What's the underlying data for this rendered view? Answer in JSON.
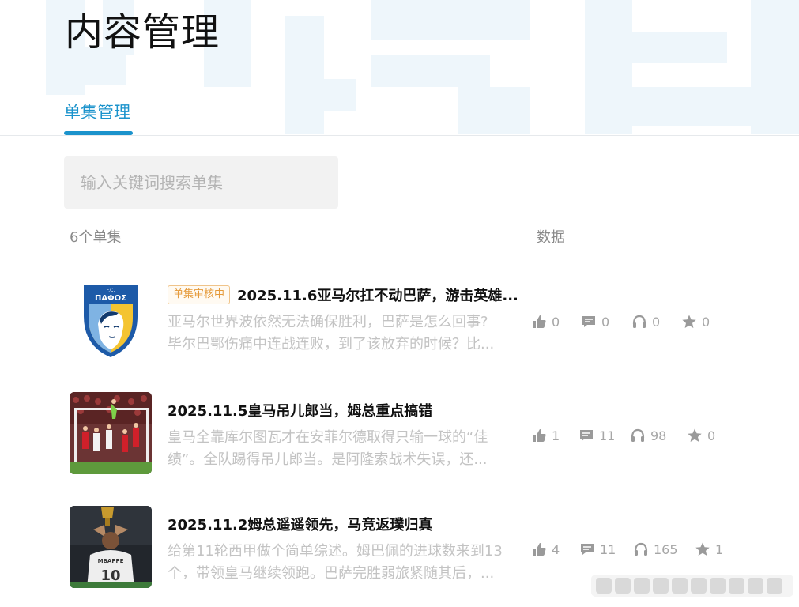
{
  "header": {
    "title": "内容管理"
  },
  "tabs": [
    {
      "label": "单集管理",
      "active": true
    }
  ],
  "search": {
    "placeholder": "输入关键词搜索单集",
    "value": ""
  },
  "list": {
    "count_label": "6个单集",
    "data_label": "数据",
    "episodes": [
      {
        "badge": "单集审核中",
        "title": "2025.11.6亚马尔扛不动巴萨，游击英雄...",
        "desc_line1": "亚马尔世界波依然无法确保胜利，巴萨是怎么回事?",
        "desc_line2": "毕尔巴鄂伤痛中连战连败，到了该放弃的时候？比...",
        "thumb_icon": "pafos-club-crest",
        "stats": {
          "likes": "0",
          "comments": "0",
          "listens": "0",
          "stars": "0"
        }
      },
      {
        "badge": "",
        "title": "2025.11.5皇马吊儿郎当，姆总重点搞错",
        "desc_line1": "皇马全靠库尔图瓦才在安菲尔德取得只输一球的“佳",
        "desc_line2": "绩”。全队踢得吊儿郎当。是阿隆索战术失误，还...",
        "thumb_icon": "football-match-photo",
        "stats": {
          "likes": "1",
          "comments": "11",
          "listens": "98",
          "stars": "0"
        }
      },
      {
        "badge": "",
        "title": "2025.11.2姆总遥遥领先，马竞返璞归真",
        "desc_line1": "给第11轮西甲做个简单综述。姆巴佩的进球数来到13",
        "desc_line2": "个，带领皇马继续领跑。巴萨完胜弱旅紧随其后，...",
        "thumb_icon": "mbappe-trophy-photo",
        "stats": {
          "likes": "4",
          "comments": "11",
          "listens": "165",
          "stars": "1"
        }
      }
    ]
  },
  "colors": {
    "accent": "#1b93cc",
    "badge_text": "#e59a3a",
    "badge_border": "#f0c48a",
    "muted_text": "#c3c3c3",
    "stat_icon": "#9a9a9a"
  }
}
